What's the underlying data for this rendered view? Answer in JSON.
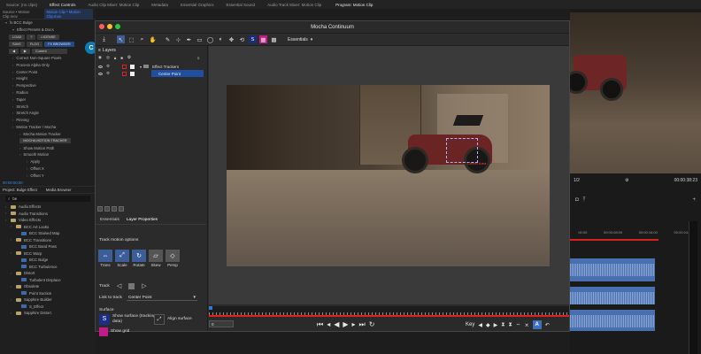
{
  "topbar": {
    "tabs": [
      {
        "label": "Source: (no clips)",
        "active": false
      },
      {
        "label": "Effect Controls",
        "active": true
      },
      {
        "label": "Audio Clip Mixer: Motion Clip",
        "active": false
      },
      {
        "label": "Metadata",
        "active": false
      },
      {
        "label": "Essential Graphics",
        "active": false
      },
      {
        "label": "Essential Sound",
        "active": false
      },
      {
        "label": "Audio Track Mixer: Motion Clip",
        "active": false
      }
    ],
    "program_tab": "Program: Motion Clip"
  },
  "effect_controls": {
    "source": "Source • Motion Clip.mov",
    "clip": "Motion Clip • Motion Clip.mov",
    "timecodes": [
      "00:00",
      "00:00:08:00",
      "00:00:32:00"
    ],
    "effect_name": "fx  BCC Bulge",
    "presets_label": "Effect Presets & Docs",
    "buttons_row1": [
      "LOAD",
      "?",
      "LICENSE"
    ],
    "buttons_row2": [
      "SAVE",
      "FLOG",
      "FX BROWSER"
    ],
    "current_label": "Current",
    "params": [
      {
        "label": "Correct Non-Square Pixels",
        "indent": 1
      },
      {
        "label": "Process Alpha Only",
        "indent": 1
      },
      {
        "label": "Center Point",
        "indent": 1
      },
      {
        "label": "Height",
        "indent": 1
      },
      {
        "label": "Perspective",
        "indent": 1
      },
      {
        "label": "Radius",
        "indent": 1
      },
      {
        "label": "Taper",
        "indent": 1
      },
      {
        "label": "Stretch",
        "indent": 1
      },
      {
        "label": "Stretch Angle",
        "indent": 1
      },
      {
        "label": "Pinning",
        "indent": 1
      },
      {
        "label": "Motion Tracker / Mocha",
        "indent": 1
      },
      {
        "label": "Mocha Motion Tracker",
        "indent": 2
      }
    ],
    "mocha_button": "MOCHA MOTION TRACKER",
    "params2": [
      {
        "label": "Show Motion Path",
        "indent": 2
      },
      {
        "label": "Smooth Motion",
        "indent": 2
      },
      {
        "label": "Apply",
        "indent": 3
      },
      {
        "label": "Offset X",
        "indent": 3
      },
      {
        "label": "Offset Y",
        "indent": 3
      }
    ],
    "timecode": "00:00:00:00"
  },
  "project": {
    "tabs": [
      "Project: Bulge Effect",
      "Media Browser"
    ],
    "search_value": "be",
    "items": [
      {
        "label": "Audio Effects",
        "type": "folder",
        "indent": 0
      },
      {
        "label": "Audio Transitions",
        "type": "folder",
        "indent": 0
      },
      {
        "label": "Video Effects",
        "type": "folder",
        "indent": 0
      },
      {
        "label": "BCC Art Looks",
        "type": "folder",
        "indent": 1
      },
      {
        "label": "BCC Stained Map",
        "type": "fx",
        "indent": 2
      },
      {
        "label": "BCC Transitions",
        "type": "folder",
        "indent": 1
      },
      {
        "label": "BCC Band Pass",
        "type": "fx",
        "indent": 2
      },
      {
        "label": "BCC Warp",
        "type": "folder",
        "indent": 1
      },
      {
        "label": "BCC Bulge",
        "type": "fx",
        "indent": 2
      },
      {
        "label": "BCC Turbulence",
        "type": "fx",
        "indent": 2
      },
      {
        "label": "Distort",
        "type": "folder",
        "indent": 1
      },
      {
        "label": "Turbulent Displace",
        "type": "fx",
        "indent": 2
      },
      {
        "label": "Obsolete",
        "type": "folder",
        "indent": 1
      },
      {
        "label": "Point Suction",
        "type": "fx",
        "indent": 2
      },
      {
        "label": "Sapphire Builder",
        "type": "folder",
        "indent": 1
      },
      {
        "label": "S_Effect",
        "type": "fx",
        "indent": 2
      },
      {
        "label": "Sapphire Distort",
        "type": "folder",
        "indent": 1
      }
    ]
  },
  "mocha": {
    "title": "Mocha Continuum",
    "workspace": "Essentials",
    "layers_title": "Layers",
    "tree": {
      "parent": "Effect Trackers",
      "child": "Center Point"
    },
    "tabs": [
      "Essentials",
      "Layer Properties"
    ],
    "track_motion_label": "Track motion options",
    "motion_options": [
      {
        "label": "Trans",
        "icon": "⇔",
        "on": true
      },
      {
        "label": "Scale",
        "icon": "⤢",
        "on": true
      },
      {
        "label": "Rotate",
        "icon": "↻",
        "on": true
      },
      {
        "label": "Skew",
        "icon": "▱",
        "on": false
      },
      {
        "label": "Persp",
        "icon": "◇",
        "on": false
      }
    ],
    "track_label": "Track",
    "link_label": "Link to track",
    "link_value": "Center Point",
    "surface_label": "Surface",
    "show_surface": "Show surface (tracking data)",
    "align_surface": "Align surface",
    "show_grid": "Show grid",
    "overlay_label": "Center Area",
    "frame_value": "0",
    "key_label": "Key"
  },
  "program": {
    "zoom": "1/2",
    "timecode": "00:00:38:23",
    "ruler": [
      "00:00",
      "00:00:08:00",
      "00:00:16:00",
      "00:00:24:00"
    ]
  }
}
